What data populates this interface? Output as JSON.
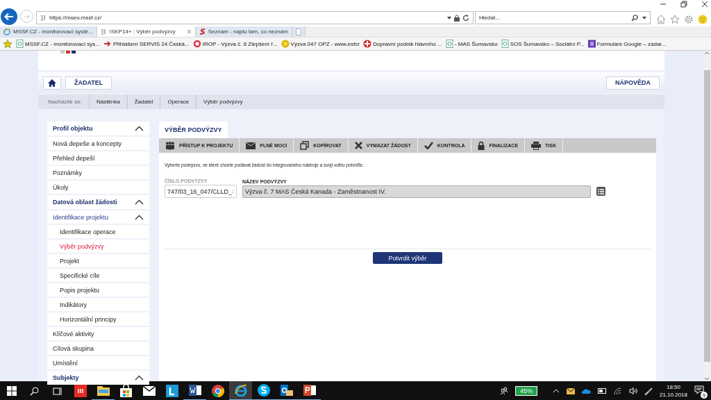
{
  "browser": {
    "url": "https://mseu.mssf.cz/",
    "search_placeholder": "Hledat...",
    "tabs": [
      {
        "label": "MSSF.CZ - monitorovací systé...",
        "kind": "ie",
        "selected": false
      },
      {
        "label": "ISKP14+ : Výběr podvýzvy",
        "kind": "grid",
        "selected": true
      },
      {
        "label": "Seznam - najdu tam, co neznám",
        "kind": "seznam",
        "selected": false
      }
    ],
    "favorites": [
      {
        "label": "MSSF.CZ - monitorovací sys...",
        "kind": "page"
      },
      {
        "label": "Přihlášení SERVIS 24  Česká...",
        "kind": "arrow"
      },
      {
        "label": "IROP - Výzva č. 6 Zlepšení ř...",
        "kind": "ring"
      },
      {
        "label": "Výzva 047 OPZ - www.esfcr",
        "kind": "coin"
      },
      {
        "label": "Dopravní podnik hlavního ...",
        "kind": "cross"
      },
      {
        "label": "- MAS Šumavsko",
        "kind": "page"
      },
      {
        "label": "SOS Šumavsko – Sociální P...",
        "kind": "page"
      },
      {
        "label": "Formuláre Google – zadar...",
        "kind": "form"
      }
    ]
  },
  "nav": {
    "applicant": "ŽADATEL",
    "help": "NÁPOVĚDA"
  },
  "breadcrumb": {
    "label": "Nacházíte se:",
    "items": [
      "Nástěnka",
      "Žadatel",
      "Operace",
      "Výběr podvýzvy"
    ]
  },
  "sidebar": [
    {
      "label": "Profil objektu",
      "expanded": true,
      "children": [
        {
          "label": "Nová depeše a koncepty",
          "selected": false
        },
        {
          "label": "Přehled depeší",
          "selected": false
        },
        {
          "label": "Poznámky",
          "selected": false
        },
        {
          "label": "Úkoly",
          "selected": false
        }
      ]
    },
    {
      "label": "Datová oblast žádosti",
      "expanded": true,
      "children": [
        {
          "label": "Identifikace projektu",
          "expanded": true,
          "children": [
            {
              "label": "Identifikace operace",
              "selected": false
            },
            {
              "label": "Výběr podvýzvy",
              "selected": true
            },
            {
              "label": "Projekt",
              "selected": false
            },
            {
              "label": "Specifické cíle",
              "selected": false
            },
            {
              "label": "Popis projektu",
              "selected": false
            },
            {
              "label": "Indikátory",
              "selected": false
            },
            {
              "label": "Horizontální principy",
              "selected": false
            }
          ]
        },
        {
          "label": "Klíčové aktivity",
          "selected": false
        },
        {
          "label": "Cílová skupina",
          "selected": false
        },
        {
          "label": "Umístění",
          "selected": false
        }
      ]
    },
    {
      "label": "Subjekty",
      "expanded": true
    }
  ],
  "content": {
    "tab": "VÝBĚR PODVÝZVY",
    "actions": [
      {
        "label": "PŘÍSTUP K PROJEKTU",
        "kind": "people"
      },
      {
        "label": "PLNÉ MOCI",
        "kind": "mail"
      },
      {
        "label": "KOPÍROVAT",
        "kind": "copy"
      },
      {
        "label": "VYMAZAT ŽÁDOST",
        "kind": "delete"
      },
      {
        "label": "KONTROLA",
        "kind": "check"
      },
      {
        "label": "FINALIZACE",
        "kind": "lock"
      },
      {
        "label": "TISK",
        "kind": "print"
      }
    ],
    "instruction": "Vyberte podvýzvu, ve které chcete podávat žádost do integrovaného nástroje a svoji volbu potvrďte.",
    "number_field": {
      "label": "ČÍSLO PODVÝZVY",
      "value": "747/03_16_047/CLLD_"
    },
    "name_field": {
      "label": "NÁZEV PODVÝZVY",
      "value": "Výzva č. 7 MAS Česká Kanada - Zaměstnanost IV."
    },
    "confirm": "Potvrdit výběr"
  },
  "taskbar": {
    "apps": [
      {
        "kind": "red",
        "running": false,
        "selected": false
      },
      {
        "kind": "folder",
        "running": true,
        "selected": false
      },
      {
        "kind": "store",
        "running": false,
        "selected": false
      },
      {
        "kind": "mail",
        "running": false,
        "selected": false
      },
      {
        "kind": "letter",
        "running": false,
        "selected": false
      },
      {
        "kind": "word",
        "running": true,
        "selected": false
      },
      {
        "kind": "chrome",
        "running": false,
        "selected": false
      },
      {
        "kind": "ie",
        "running": true,
        "selected": true
      },
      {
        "kind": "skype",
        "running": true,
        "selected": false
      },
      {
        "kind": "outlook",
        "running": true,
        "selected": false
      },
      {
        "kind": "powerpoint",
        "running": true,
        "selected": false
      }
    ],
    "battery": "45%",
    "time": "18:50",
    "date": "21.10.2018",
    "notifications": "9"
  }
}
